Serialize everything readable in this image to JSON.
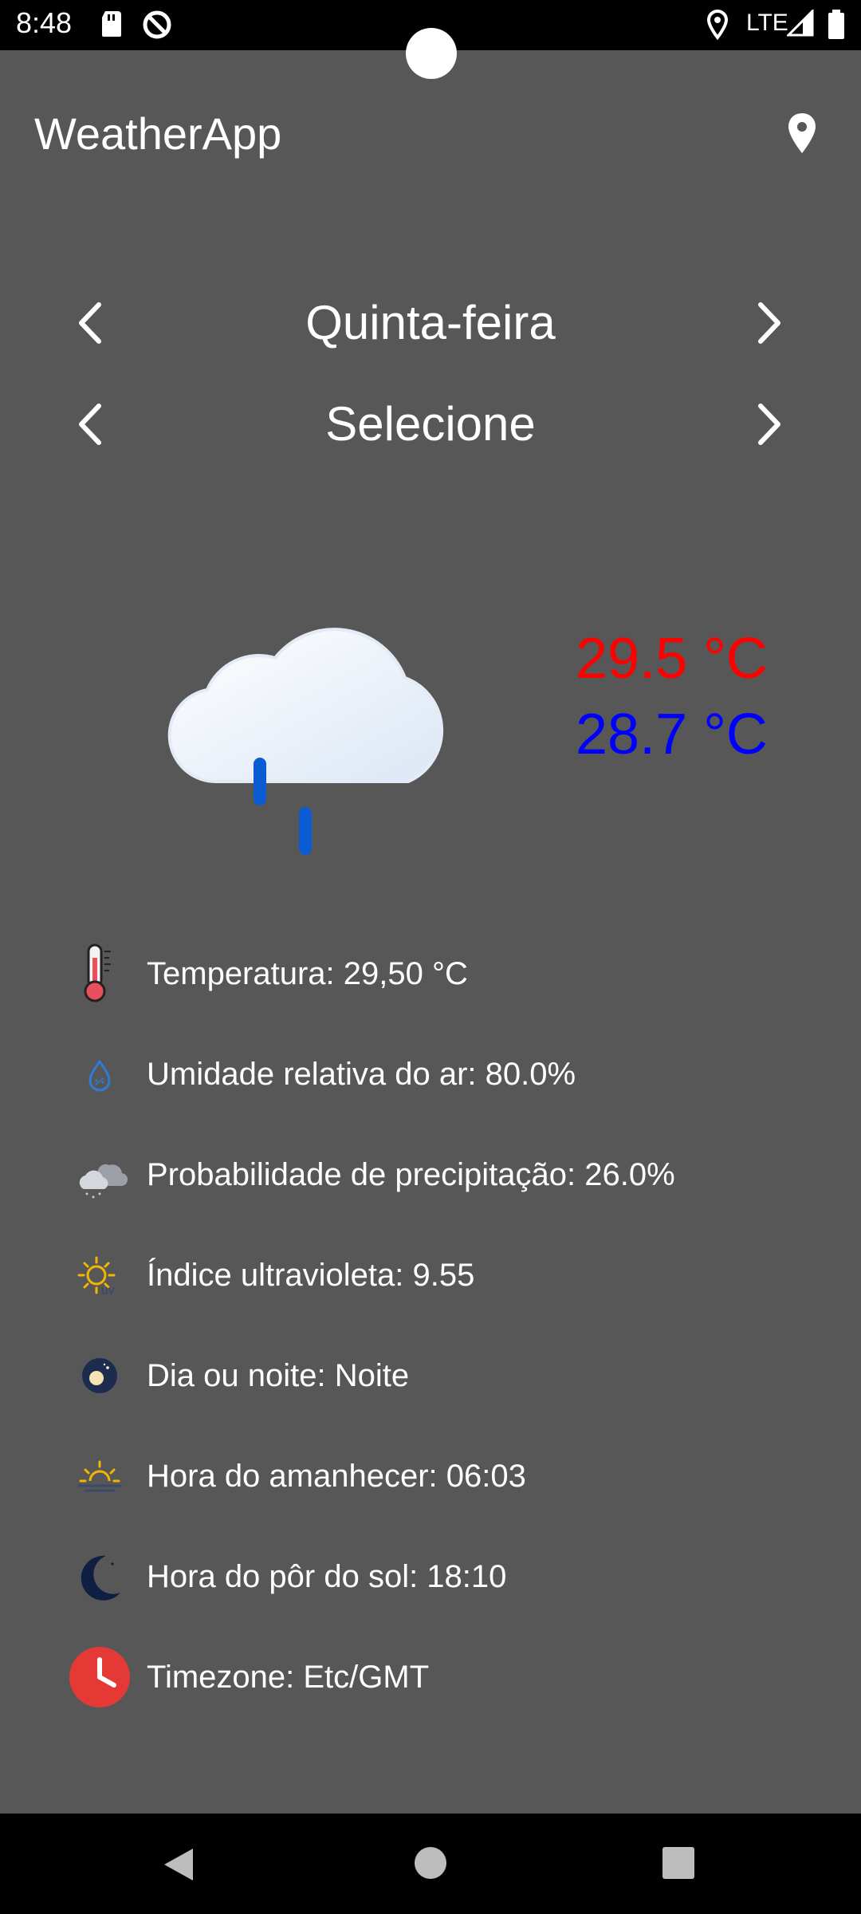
{
  "status_bar": {
    "time": "8:48",
    "network": "LTE"
  },
  "app_bar": {
    "title": "WeatherApp"
  },
  "day_selector": {
    "label": "Quinta-feira"
  },
  "hour_selector": {
    "label": "Selecione"
  },
  "current": {
    "max_temp": "29.5 °C",
    "min_temp": "28.7 °C",
    "max_color": "#ff0000",
    "min_color": "#0000ff"
  },
  "details": [
    {
      "icon": "thermometer-icon",
      "text": "Temperatura: 29,50 °C"
    },
    {
      "icon": "humidity-drop-icon",
      "text": "Umidade relativa do ar: 80.0%"
    },
    {
      "icon": "precipitation-cloud-icon",
      "text": "Probabilidade de precipitação: 26.0%"
    },
    {
      "icon": "uv-sun-icon",
      "text": "Índice ultravioleta: 9.55"
    },
    {
      "icon": "day-night-icon",
      "text": "Dia ou noite: Noite"
    },
    {
      "icon": "sunrise-icon",
      "text": "Hora do amanhecer: 06:03"
    },
    {
      "icon": "moon-icon",
      "text": "Hora do pôr do sol: 18:10"
    },
    {
      "icon": "clock-icon",
      "text": "Timezone: Etc/GMT"
    }
  ]
}
